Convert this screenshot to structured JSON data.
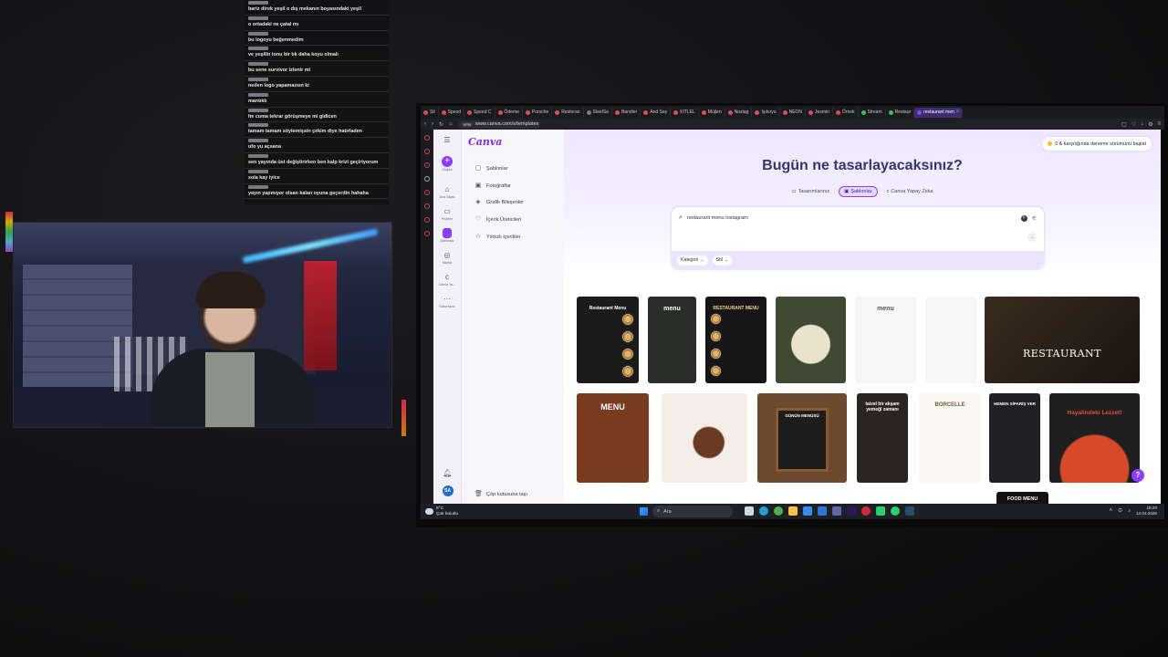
{
  "chat": {
    "messages": [
      "bariz direk yeşil o dış mekanın boyasındaki yeşil",
      "o ortadaki ne çatal mı",
      "bu logoyu beğenmedim",
      "ve yeşilin tonu bir tık daha koyu olmalı",
      "bu sene survivor izlenir mi",
      "neden logo yapamazsın ki",
      "mantıklı",
      "he cuma tekrar görüşmeye mi gidicen",
      "tamam tamam söylemişsin çekim diye hatırladım",
      "ufo yu açsana",
      "sen yayında üst değiştirirken ben kalp krizi geçiriyorum",
      "sola kay iyice",
      "yayın yapmıyor olsan kalan oyuna geçerdin hahaha"
    ]
  },
  "browser": {
    "tabs": [
      {
        "label": "Sil",
        "color": "#e04b5a"
      },
      {
        "label": "Speed",
        "color": "#e04b5a"
      },
      {
        "label": "Speed C",
        "color": "#e04b5a"
      },
      {
        "label": "Ödeme",
        "color": "#e04b5a"
      },
      {
        "label": "Porsche",
        "color": "#e04b5a"
      },
      {
        "label": "Restoran",
        "color": "#e04b5a"
      },
      {
        "label": "SteelSe",
        "color": "#7a7a80"
      },
      {
        "label": "Barstler",
        "color": "#e04b5a"
      },
      {
        "label": "And Say",
        "color": "#e04b5a"
      },
      {
        "label": "KITLEL",
        "color": "#e04b5a"
      },
      {
        "label": "Müjlen",
        "color": "#e04b5a"
      },
      {
        "label": "Nostag",
        "color": "#e04b5a"
      },
      {
        "label": "Işıkıryu",
        "color": "#e04b5a"
      },
      {
        "label": "NEON",
        "color": "#e04b5a"
      },
      {
        "label": "Jesmin",
        "color": "#e04b5a"
      },
      {
        "label": "Örnek",
        "color": "#e04b5a"
      },
      {
        "label": "Stream",
        "color": "#34c759"
      },
      {
        "label": "Restaur",
        "color": "#34c759"
      },
      {
        "label": "restaurant men",
        "color": "#8b3dff",
        "active": true
      }
    ],
    "url": "www.canva.com/s/templates",
    "vpn": "VPN"
  },
  "canva": {
    "logo": "Canva",
    "rail": [
      {
        "label": "Oluştur",
        "icon": "plus-icon"
      },
      {
        "label": "Ana Sayfa",
        "icon": "home-icon"
      },
      {
        "label": "Projeler",
        "icon": "folder-icon"
      },
      {
        "label": "Şablonlar",
        "icon": "template-icon"
      },
      {
        "label": "Marka",
        "icon": "brand-icon"
      },
      {
        "label": "Canva Ya...",
        "icon": "ai-icon"
      },
      {
        "label": "Daha fazla",
        "icon": "more-icon"
      }
    ],
    "avatar": "SA",
    "side_menu": [
      {
        "label": "Şablonlar",
        "icon": "▢"
      },
      {
        "label": "Fotoğraflar",
        "icon": "▣"
      },
      {
        "label": "Grafik Bileşenler",
        "icon": "◈"
      },
      {
        "label": "İçerik Üreticileri",
        "icon": "♡"
      },
      {
        "label": "Yıldızlı içerikler",
        "icon": "☆"
      }
    ],
    "trash": "Çöp kutusuna taşı",
    "trial": "0 ₺ karşılığında deneme sürümünü başlat",
    "title": "Bugün ne tasarlayacaksınız?",
    "tabs": [
      "Tasarımlarınız",
      "Şablonlar",
      "Canva Yapay Zeka"
    ],
    "search_value": "restaurant menu instagram",
    "filters": [
      "Kategori",
      "Stil"
    ],
    "cards": [
      {
        "title": "Restaurant Menu",
        "bg": "#1b1b1b",
        "fg": "#ffffff"
      },
      {
        "title": "menu",
        "bg": "#2a2d2a",
        "fg": "#ffffff"
      },
      {
        "title": "RESTAURANT MENU",
        "bg": "#161616",
        "fg": "#f2d28b"
      },
      {
        "title": "",
        "bg": "#3f4a35",
        "fg": "#ffffff"
      },
      {
        "title": "menu",
        "bg": "#f6f6f6",
        "fg": "#555555"
      },
      {
        "title": "",
        "bg": "#f7f7f7",
        "fg": "#555555"
      },
      {
        "title": "RESTAURANT",
        "bg": "#2a2018",
        "fg": "#ffffff"
      },
      {
        "title": "MENU",
        "bg": "#7a3a1e",
        "fg": "#ffffff"
      },
      {
        "title": "",
        "bg": "#f3eee8",
        "fg": "#333333"
      },
      {
        "title": "GÜNÜN MENÜSÜ",
        "bg": "#6b4a2e",
        "fg": "#ffffff"
      },
      {
        "title": "taizel bir akşam yemeği zamanı",
        "bg": "#2b2420",
        "fg": "#ffffff"
      },
      {
        "title": "BORCELLE",
        "bg": "#fbf8f1",
        "fg": "#6b5a3b"
      },
      {
        "title": "HEMEN SİPARİŞ VER",
        "bg": "#1f1f24",
        "fg": "#ffffff"
      },
      {
        "title": "Hayalindeki Lezzet!",
        "bg": "#1f1f1f",
        "fg": "#e84a3a"
      },
      {
        "title": "FOOD MENU",
        "bg": "#111111",
        "fg": "#ffffff"
      }
    ],
    "help": "?"
  },
  "taskbar": {
    "temp": "8°C",
    "weather": "Çok bulutlu",
    "search": "Ara",
    "time": "18:20",
    "date": "14.01.2026"
  }
}
